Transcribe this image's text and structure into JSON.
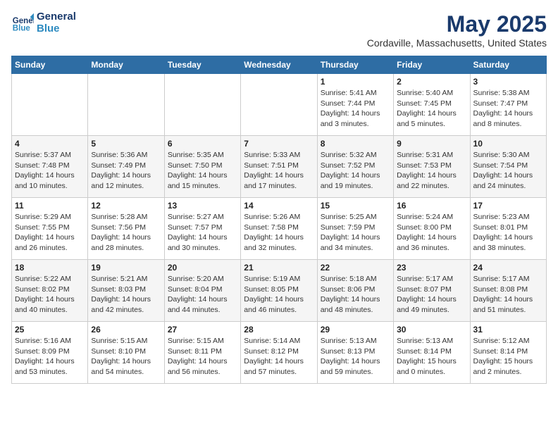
{
  "header": {
    "logo_line1": "General",
    "logo_line2": "Blue",
    "title": "May 2025",
    "subtitle": "Cordaville, Massachusetts, United States"
  },
  "weekdays": [
    "Sunday",
    "Monday",
    "Tuesday",
    "Wednesday",
    "Thursday",
    "Friday",
    "Saturday"
  ],
  "weeks": [
    [
      {
        "day": "",
        "info": ""
      },
      {
        "day": "",
        "info": ""
      },
      {
        "day": "",
        "info": ""
      },
      {
        "day": "",
        "info": ""
      },
      {
        "day": "1",
        "info": "Sunrise: 5:41 AM\nSunset: 7:44 PM\nDaylight: 14 hours\nand 3 minutes."
      },
      {
        "day": "2",
        "info": "Sunrise: 5:40 AM\nSunset: 7:45 PM\nDaylight: 14 hours\nand 5 minutes."
      },
      {
        "day": "3",
        "info": "Sunrise: 5:38 AM\nSunset: 7:47 PM\nDaylight: 14 hours\nand 8 minutes."
      }
    ],
    [
      {
        "day": "4",
        "info": "Sunrise: 5:37 AM\nSunset: 7:48 PM\nDaylight: 14 hours\nand 10 minutes."
      },
      {
        "day": "5",
        "info": "Sunrise: 5:36 AM\nSunset: 7:49 PM\nDaylight: 14 hours\nand 12 minutes."
      },
      {
        "day": "6",
        "info": "Sunrise: 5:35 AM\nSunset: 7:50 PM\nDaylight: 14 hours\nand 15 minutes."
      },
      {
        "day": "7",
        "info": "Sunrise: 5:33 AM\nSunset: 7:51 PM\nDaylight: 14 hours\nand 17 minutes."
      },
      {
        "day": "8",
        "info": "Sunrise: 5:32 AM\nSunset: 7:52 PM\nDaylight: 14 hours\nand 19 minutes."
      },
      {
        "day": "9",
        "info": "Sunrise: 5:31 AM\nSunset: 7:53 PM\nDaylight: 14 hours\nand 22 minutes."
      },
      {
        "day": "10",
        "info": "Sunrise: 5:30 AM\nSunset: 7:54 PM\nDaylight: 14 hours\nand 24 minutes."
      }
    ],
    [
      {
        "day": "11",
        "info": "Sunrise: 5:29 AM\nSunset: 7:55 PM\nDaylight: 14 hours\nand 26 minutes."
      },
      {
        "day": "12",
        "info": "Sunrise: 5:28 AM\nSunset: 7:56 PM\nDaylight: 14 hours\nand 28 minutes."
      },
      {
        "day": "13",
        "info": "Sunrise: 5:27 AM\nSunset: 7:57 PM\nDaylight: 14 hours\nand 30 minutes."
      },
      {
        "day": "14",
        "info": "Sunrise: 5:26 AM\nSunset: 7:58 PM\nDaylight: 14 hours\nand 32 minutes."
      },
      {
        "day": "15",
        "info": "Sunrise: 5:25 AM\nSunset: 7:59 PM\nDaylight: 14 hours\nand 34 minutes."
      },
      {
        "day": "16",
        "info": "Sunrise: 5:24 AM\nSunset: 8:00 PM\nDaylight: 14 hours\nand 36 minutes."
      },
      {
        "day": "17",
        "info": "Sunrise: 5:23 AM\nSunset: 8:01 PM\nDaylight: 14 hours\nand 38 minutes."
      }
    ],
    [
      {
        "day": "18",
        "info": "Sunrise: 5:22 AM\nSunset: 8:02 PM\nDaylight: 14 hours\nand 40 minutes."
      },
      {
        "day": "19",
        "info": "Sunrise: 5:21 AM\nSunset: 8:03 PM\nDaylight: 14 hours\nand 42 minutes."
      },
      {
        "day": "20",
        "info": "Sunrise: 5:20 AM\nSunset: 8:04 PM\nDaylight: 14 hours\nand 44 minutes."
      },
      {
        "day": "21",
        "info": "Sunrise: 5:19 AM\nSunset: 8:05 PM\nDaylight: 14 hours\nand 46 minutes."
      },
      {
        "day": "22",
        "info": "Sunrise: 5:18 AM\nSunset: 8:06 PM\nDaylight: 14 hours\nand 48 minutes."
      },
      {
        "day": "23",
        "info": "Sunrise: 5:17 AM\nSunset: 8:07 PM\nDaylight: 14 hours\nand 49 minutes."
      },
      {
        "day": "24",
        "info": "Sunrise: 5:17 AM\nSunset: 8:08 PM\nDaylight: 14 hours\nand 51 minutes."
      }
    ],
    [
      {
        "day": "25",
        "info": "Sunrise: 5:16 AM\nSunset: 8:09 PM\nDaylight: 14 hours\nand 53 minutes."
      },
      {
        "day": "26",
        "info": "Sunrise: 5:15 AM\nSunset: 8:10 PM\nDaylight: 14 hours\nand 54 minutes."
      },
      {
        "day": "27",
        "info": "Sunrise: 5:15 AM\nSunset: 8:11 PM\nDaylight: 14 hours\nand 56 minutes."
      },
      {
        "day": "28",
        "info": "Sunrise: 5:14 AM\nSunset: 8:12 PM\nDaylight: 14 hours\nand 57 minutes."
      },
      {
        "day": "29",
        "info": "Sunrise: 5:13 AM\nSunset: 8:13 PM\nDaylight: 14 hours\nand 59 minutes."
      },
      {
        "day": "30",
        "info": "Sunrise: 5:13 AM\nSunset: 8:14 PM\nDaylight: 15 hours\nand 0 minutes."
      },
      {
        "day": "31",
        "info": "Sunrise: 5:12 AM\nSunset: 8:14 PM\nDaylight: 15 hours\nand 2 minutes."
      }
    ]
  ]
}
